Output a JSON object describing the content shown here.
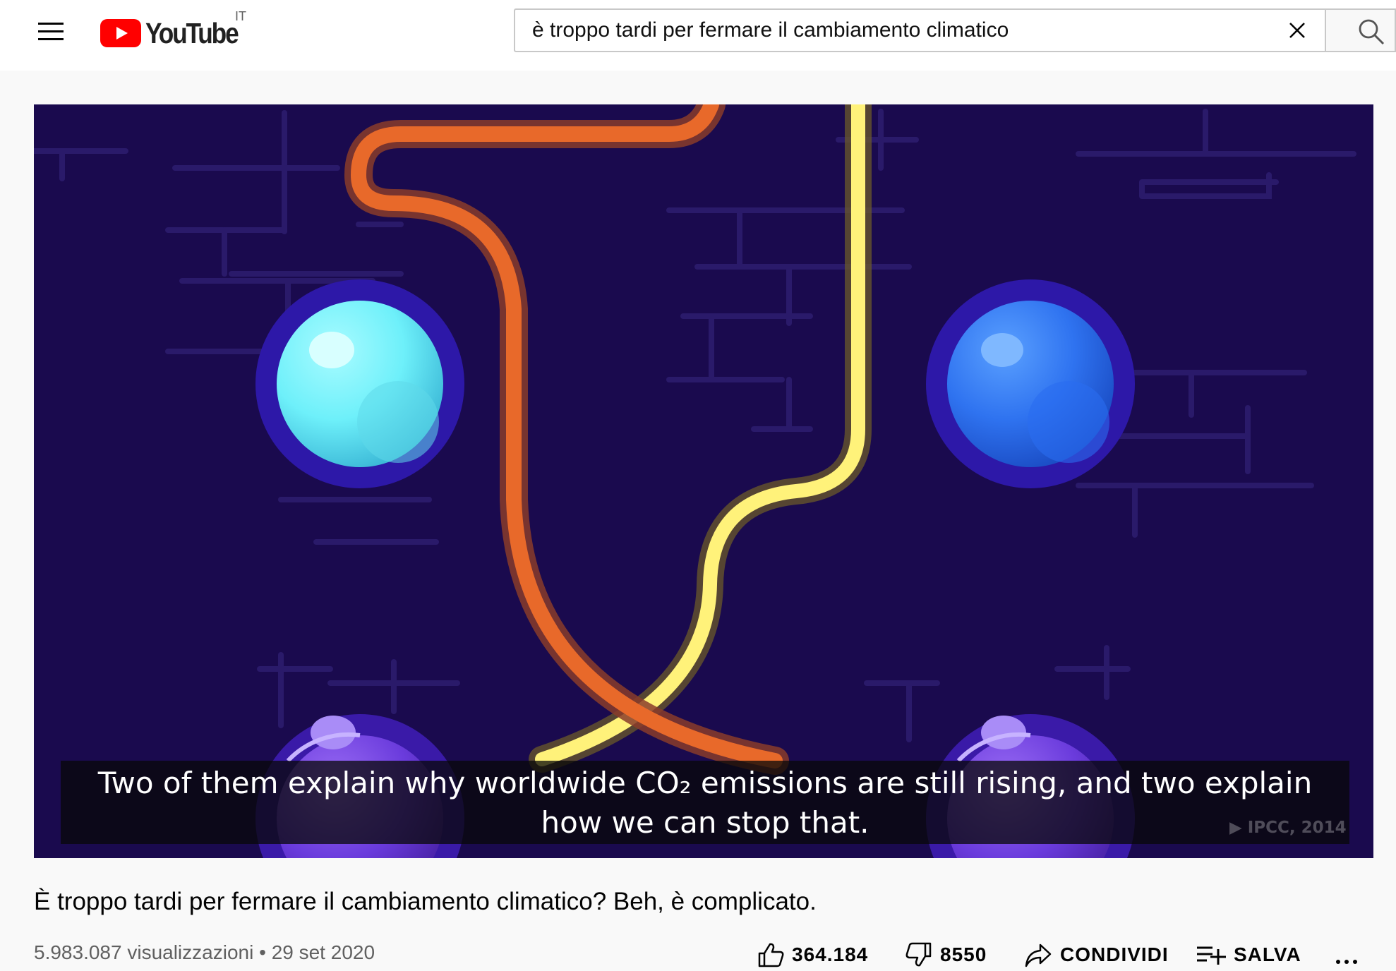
{
  "header": {
    "menu_icon": "hamburger-menu-icon",
    "logo_text": "YouTube",
    "region": "IT",
    "search": {
      "value": "è troppo tardi per fermare il cambiamento climatico",
      "clear_icon": "close-icon",
      "search_icon": "search-icon"
    }
  },
  "player": {
    "caption_lines": [
      "Two of them explain why worldwide CO₂ emissions are still rising, and two explain",
      "how we can stop that."
    ],
    "watermark": "▶ IPCC, 2014"
  },
  "video": {
    "title": "È troppo tardi per fermare il cambiamento climatico? Beh, è complicato.",
    "views": "5.983.087 visualizzazioni",
    "separator": "•",
    "date": "29 set 2020",
    "likes": "364.184",
    "dislikes": "8550",
    "share_label": "CONDIVIDI",
    "save_label": "SALVA",
    "more_icon": "more-actions-icon"
  },
  "colors": {
    "brand_red": "#ff0000",
    "player_bg": "#1a0a4e",
    "orange_pipe": "#e8692a",
    "yellow_pipe": "#fff27a"
  }
}
